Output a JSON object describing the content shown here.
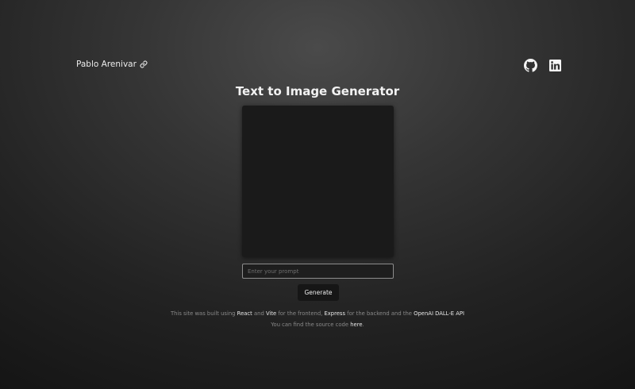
{
  "header": {
    "author_name": "Pablo Arenivar",
    "icons": {
      "author_link": "link-icon",
      "github": "github-icon",
      "linkedin": "linkedin-icon"
    }
  },
  "main": {
    "title": "Text to Image Generator",
    "prompt_placeholder": "Enter your prompt",
    "prompt_value": "",
    "generate_label": "Generate"
  },
  "footer": {
    "line1": {
      "t1": "This site was built using ",
      "react": "React",
      "t2": " and ",
      "vite": "Vite",
      "t3": " for the frontend, ",
      "express": "Express",
      "t4": " for the backend and the ",
      "openai": "OpenAI DALL-E API"
    },
    "line2": {
      "t1": "You can find the source code ",
      "here": "here",
      "t2": "."
    }
  },
  "colors": {
    "background_center": "#4a4a4a",
    "background_edge": "#121212",
    "image_frame": "#1a1a1a",
    "button": "#161616",
    "input_border": "#8d8d8d"
  }
}
